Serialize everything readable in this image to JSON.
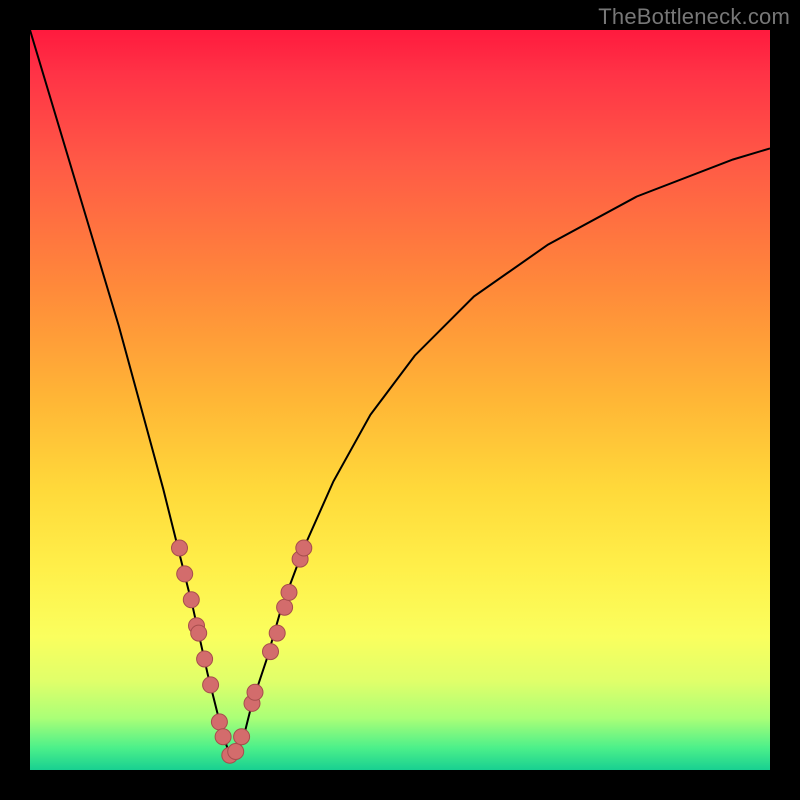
{
  "watermark": "TheBottleneck.com",
  "chart_data": {
    "type": "line",
    "title": "",
    "xlabel": "",
    "ylabel": "",
    "xlim": [
      0,
      100
    ],
    "ylim": [
      0,
      100
    ],
    "grid": false,
    "legend": false,
    "note": "Axes are unlabeled; values estimated in percent of plot area. Curve resembles a bottleneck V with minimum near x≈27.",
    "series": [
      {
        "name": "curve",
        "type": "line",
        "x": [
          0,
          3,
          6,
          9,
          12,
          15,
          18,
          20,
          22,
          24,
          25,
          26,
          27,
          28,
          29,
          30,
          32,
          34,
          37,
          41,
          46,
          52,
          60,
          70,
          82,
          95,
          100
        ],
        "y": [
          100,
          90,
          80,
          70,
          60,
          49,
          38,
          30,
          22,
          13,
          9,
          5,
          2,
          2,
          5,
          9,
          15,
          22,
          30,
          39,
          48,
          56,
          64,
          71,
          77.5,
          82.5,
          84
        ]
      },
      {
        "name": "highlight-dots",
        "type": "scatter",
        "x": [
          20.2,
          20.9,
          21.8,
          22.5,
          22.8,
          23.6,
          24.4,
          25.6,
          26.1,
          27.0,
          27.8,
          28.6,
          30.0,
          30.4,
          32.5,
          33.4,
          34.4,
          35.0,
          36.5,
          37.0
        ],
        "y": [
          30.0,
          26.5,
          23.0,
          19.5,
          18.5,
          15.0,
          11.5,
          6.5,
          4.5,
          2.0,
          2.5,
          4.5,
          9.0,
          10.5,
          16.0,
          18.5,
          22.0,
          24.0,
          28.5,
          30.0
        ]
      }
    ]
  },
  "colors": {
    "dot_fill": "#d36c6c",
    "dot_stroke": "#a64d4d",
    "curve": "#000000",
    "frame": "#000000"
  }
}
